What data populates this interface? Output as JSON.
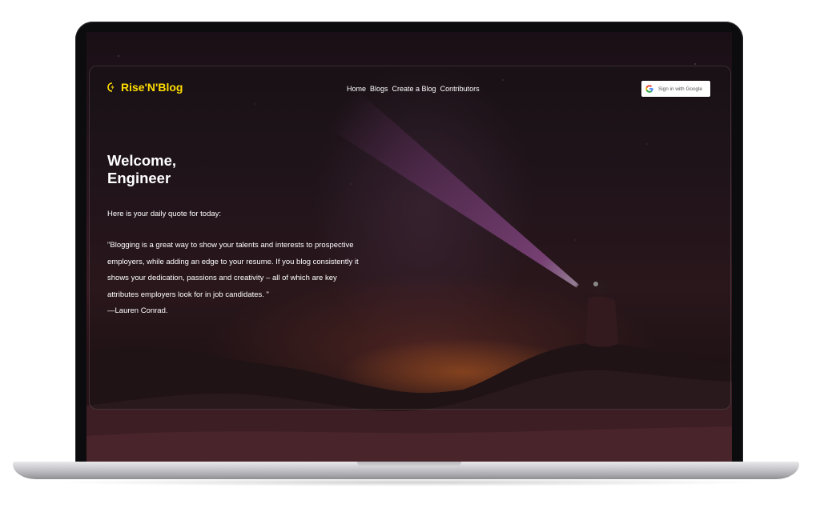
{
  "header": {
    "brand": "Rise'N'Blog",
    "nav": [
      "Home",
      "Blogs",
      "Create a Blog",
      "Contributors"
    ],
    "signin_label": "Sign in with Google"
  },
  "hero": {
    "welcome_line1": "Welcome,",
    "welcome_line2": "Engineer",
    "intro": "Here is your daily quote for today:",
    "quote_lines": [
      "\"Blogging is a great way to show your talents and interests to prospective",
      "employers, while adding an edge to your resume. If you blog consistently it",
      "shows your dedication, passions and creativity – all of which are key",
      "attributes employers look for in job candidates. \"",
      "—Lauren Conrad."
    ]
  },
  "colors": {
    "brand": "#ffdd00",
    "text": "#ffffff",
    "beam": "#d65fd6"
  },
  "icons": {
    "brand": "lightning-icon",
    "signin": "google-icon"
  }
}
